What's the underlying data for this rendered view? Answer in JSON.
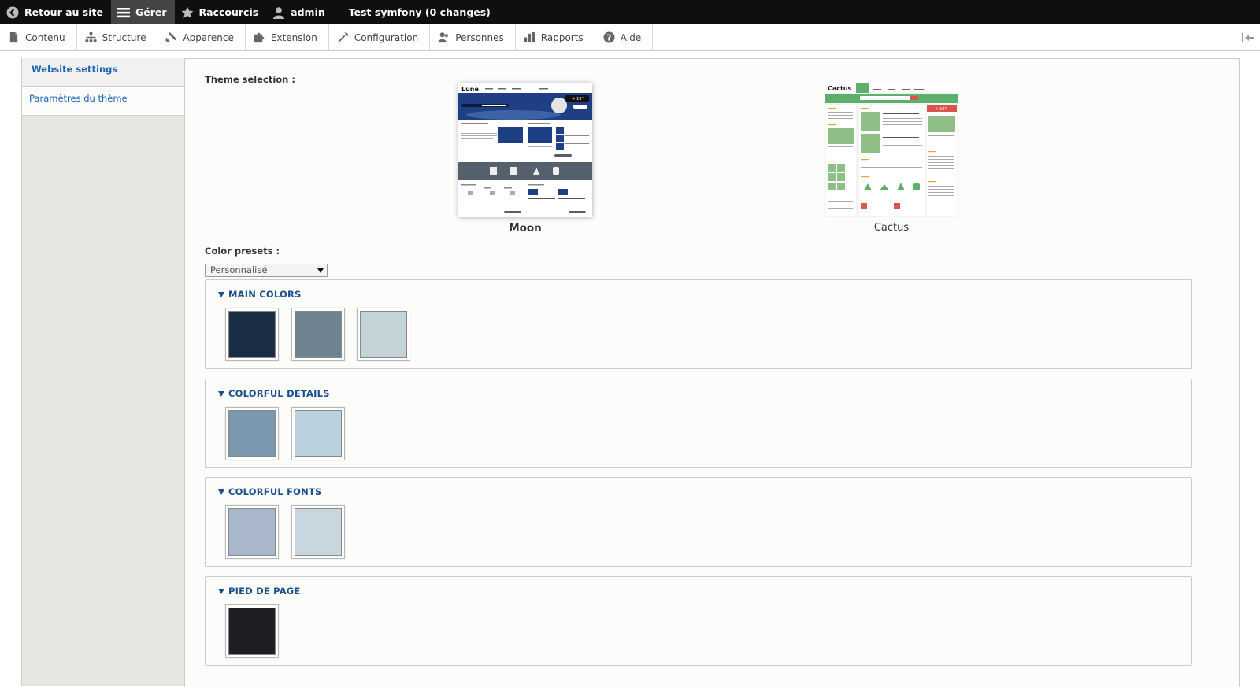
{
  "toolbar": {
    "back_label": "Retour au site",
    "manage_label": "Gérer",
    "shortcuts_label": "Raccourcis",
    "user_label": "admin",
    "site_label": "Test symfony (0 changes)"
  },
  "tray": {
    "items": [
      {
        "label": "Contenu",
        "icon": "file-icon"
      },
      {
        "label": "Structure",
        "icon": "sitemap-icon"
      },
      {
        "label": "Apparence",
        "icon": "paintbrush-icon"
      },
      {
        "label": "Extension",
        "icon": "puzzle-icon"
      },
      {
        "label": "Configuration",
        "icon": "wrench-icon"
      },
      {
        "label": "Personnes",
        "icon": "people-icon"
      },
      {
        "label": "Rapports",
        "icon": "chart-bar-icon"
      },
      {
        "label": "Aide",
        "icon": "help-icon"
      }
    ]
  },
  "sidebar": {
    "tabs": [
      {
        "label": "Website settings"
      },
      {
        "label": "Paramètres du thème"
      }
    ]
  },
  "content": {
    "theme_selection_label": "Theme selection :",
    "themes": [
      {
        "name": "Moon",
        "thumb_title": "Lune",
        "weather": "☀ 19°"
      },
      {
        "name": "Cactus",
        "thumb_title": "Cactus",
        "weather": "☀ 19°"
      }
    ],
    "color_presets_label": "Color presets :",
    "color_presets_value": "Personnalisé",
    "groups": [
      {
        "title": "MAIN COLORS",
        "colors": [
          "#1b2d45",
          "#6f8290",
          "#c3d3d7"
        ]
      },
      {
        "title": "COLORFUL DETAILS",
        "colors": [
          "#7b97b0",
          "#b9d1dc"
        ]
      },
      {
        "title": "COLORFUL FONTS",
        "colors": [
          "#a8b7ca",
          "#c8d6df"
        ]
      },
      {
        "title": "PIED DE PAGE",
        "colors": [
          "#1e1e22"
        ]
      }
    ]
  },
  "colors": {
    "link": "#1a64b3",
    "legend": "#1b4f8a",
    "toolbar_bg": "#0f0f0f",
    "cactus_green": "#5cb06b",
    "moon_blue": "#1e3f84"
  }
}
